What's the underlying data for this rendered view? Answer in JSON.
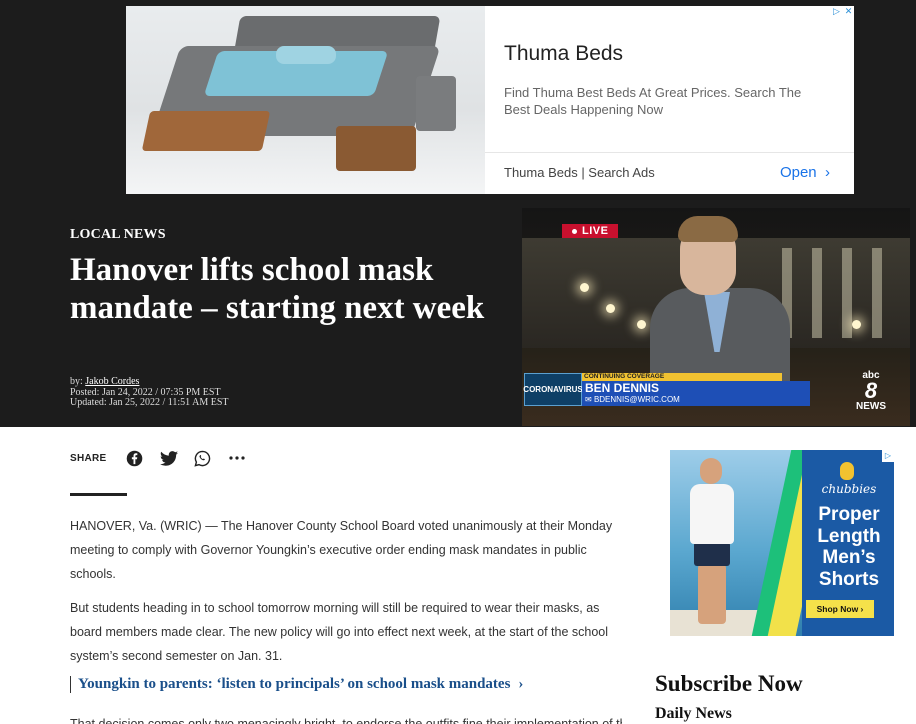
{
  "top_ad": {
    "title": "Thuma Beds",
    "description": "Find Thuma Best Beds At Great Prices. Search The Best Deals Happening Now",
    "source": "Thuma Beds | Search Ads",
    "open_label": "Open",
    "adchoices_icon": "ad-choices-icon"
  },
  "article": {
    "kicker": "LOCAL NEWS",
    "headline": "Hanover lifts school mask mandate – starting next week",
    "byline_prefix": "by: ",
    "author": "Jakob Cordes",
    "posted": "Posted: Jan 24, 2022 / 07:35 PM EST",
    "updated": "Updated: Jan 25, 2022 / 11:51 AM EST",
    "paragraphs": [
      "HANOVER, Va. (WRIC) — The Hanover County School Board voted unanimously at their Monday meeting to comply with Governor Youngkin’s executive order ending mask mandates in public schools.",
      "But students heading in to school tomorrow morning will still be required to wear their masks, as board members made clear. The new policy will go into effect next week, at the start of the school system’s second semester on Jan. 31."
    ],
    "related_link": "Youngkin to parents: ‘listen to principals’ on school mask mandates",
    "cut_off_line": "That decision comes only two menacingly bright, to endorse the outfits fine their implementation of the"
  },
  "video": {
    "live_label": "LIVE",
    "topic_label": "CORONAVIRUS",
    "strip_label": "CONTINUING COVERAGE",
    "reporter_name": "BEN DENNIS",
    "reporter_email": "BDENNIS@WRIC.COM",
    "logo_top": "abc",
    "logo_number": "8",
    "logo_bottom": "NEWS"
  },
  "share": {
    "label": "SHARE",
    "icons": [
      "facebook-icon",
      "twitter-icon",
      "whatsapp-icon",
      "more-icon"
    ]
  },
  "side_ad": {
    "brand": "chubbies",
    "headline_lines": [
      "Proper",
      "Length",
      "Men’s",
      "Shorts"
    ],
    "cta": "Shop Now ›"
  },
  "sidebar": {
    "subscribe_title": "Subscribe Now",
    "subscribe_subtitle": "Daily News"
  },
  "colors": {
    "hero_bg": "#1c1c1c",
    "link_blue": "#1a4f8a",
    "ad_open_blue": "#1a73e8",
    "live_red": "#c8102e",
    "lower_third_blue": "#1e4fb6",
    "chubbies_blue": "#1b5aa5"
  }
}
